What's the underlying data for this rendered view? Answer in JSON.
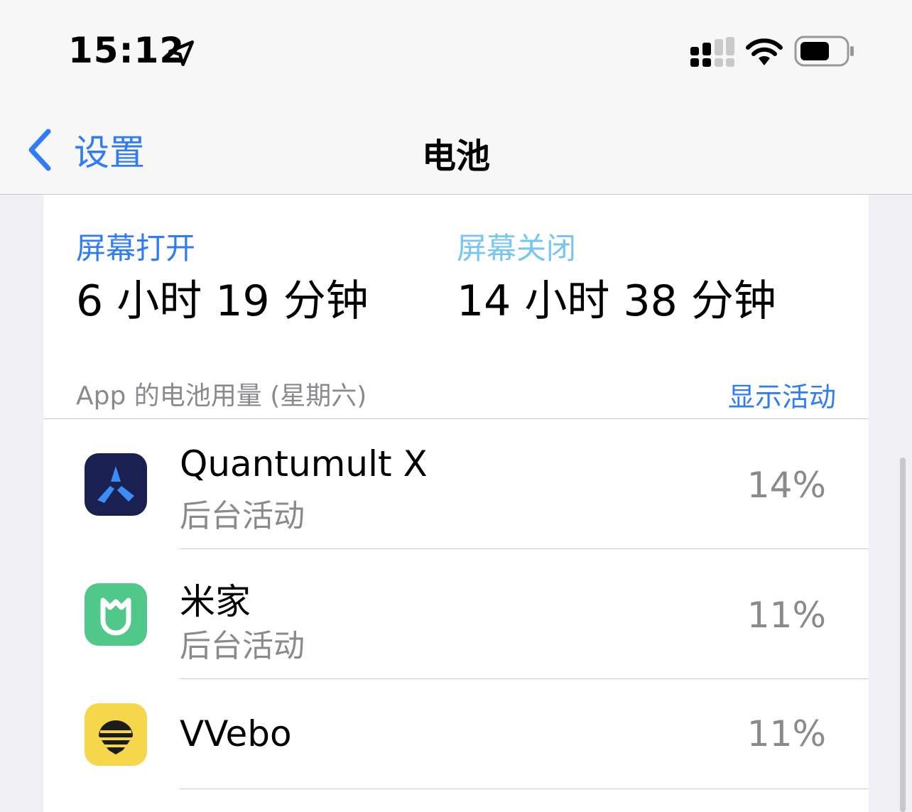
{
  "status": {
    "time": "15:12",
    "icons": [
      "location-arrow-icon",
      "cellular-signal-icon",
      "wifi-icon",
      "battery-icon"
    ]
  },
  "nav": {
    "back_label": "设置",
    "title": "电池"
  },
  "screen": {
    "on_label": "屏幕打开",
    "on_value": "6 小时 19 分钟",
    "off_label": "屏幕关闭",
    "off_value": "14 小时 38 分钟"
  },
  "usage": {
    "header": "App 的电池用量 (星期六)",
    "show_activity": "显示活动",
    "apps": [
      {
        "name": "Quantumult X",
        "detail": "后台活动",
        "percent": "14%",
        "icon": "quantumult-x-icon"
      },
      {
        "name": "米家",
        "detail": "后台活动",
        "percent": "11%",
        "icon": "mijia-icon"
      },
      {
        "name": "VVebo",
        "detail": "",
        "percent": "11%",
        "icon": "vvebo-icon"
      }
    ]
  },
  "colors": {
    "accent": "#2f7cf6",
    "screen_off": "#78c5f3",
    "secondary_text": "#8a8a8e",
    "background": "#efeff4"
  }
}
